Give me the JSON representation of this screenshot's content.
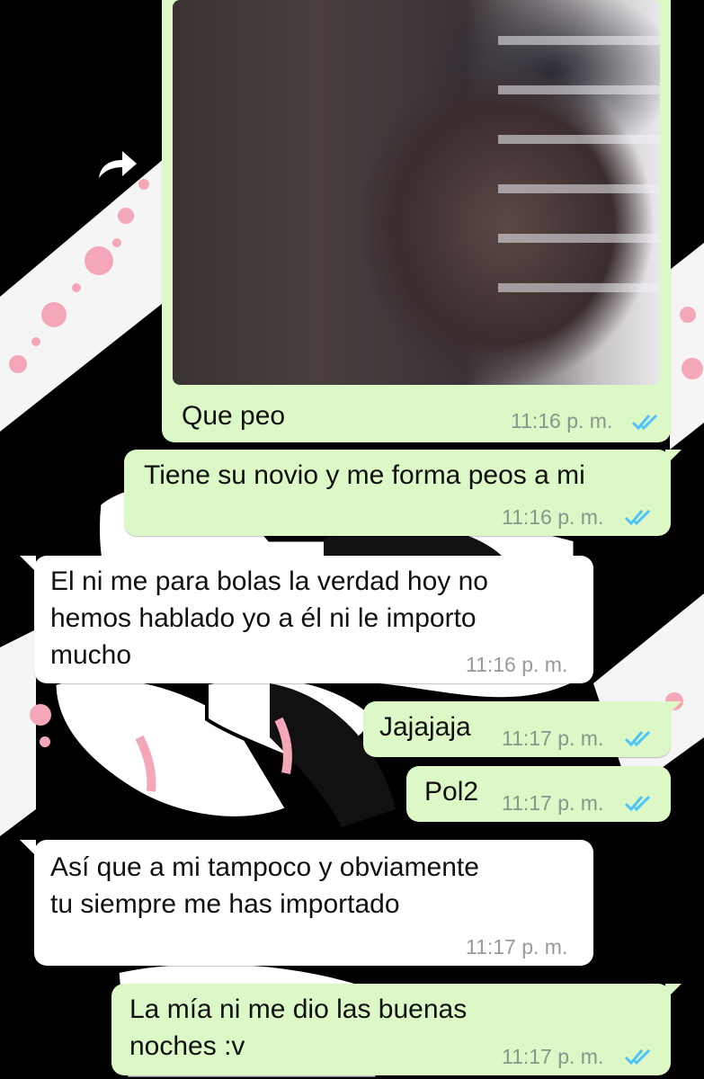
{
  "colors": {
    "outgoing_bubble": "#dcf8c6",
    "incoming_bubble": "#ffffff",
    "read_ticks": "#4fc3f7",
    "wallpaper_dots": "#f4a7b9",
    "background": "#000000"
  },
  "photo_message": {
    "caption": "Que peo",
    "time": "11:16 p. m.",
    "status_icon": "double-check-read-icon"
  },
  "messages": [
    {
      "direction": "out",
      "text": "Tiene su novio y me forma peos a mi",
      "time": "11:16 p. m.",
      "status_icon": "double-check-read-icon"
    },
    {
      "direction": "in",
      "text": "El ni me para bolas la verdad hoy no\nhemos hablado yo a él ni le importo\nmucho",
      "time": "11:16 p. m."
    },
    {
      "direction": "out",
      "text": "Jajajaja",
      "time": "11:17 p. m.",
      "status_icon": "double-check-read-icon"
    },
    {
      "direction": "out",
      "text": "Pol2",
      "time": "11:17 p. m.",
      "status_icon": "double-check-read-icon"
    },
    {
      "direction": "in",
      "text": "Así que a mi tampoco y obviamente\ntu siempre me has importado",
      "time": "11:17 p. m."
    },
    {
      "direction": "out",
      "text": "La mía ni me dio las buenas\nnoches :v",
      "time": "11:17 p. m.",
      "status_icon": "double-check-read-icon"
    }
  ],
  "forward_icon": "forward-arrow-icon"
}
